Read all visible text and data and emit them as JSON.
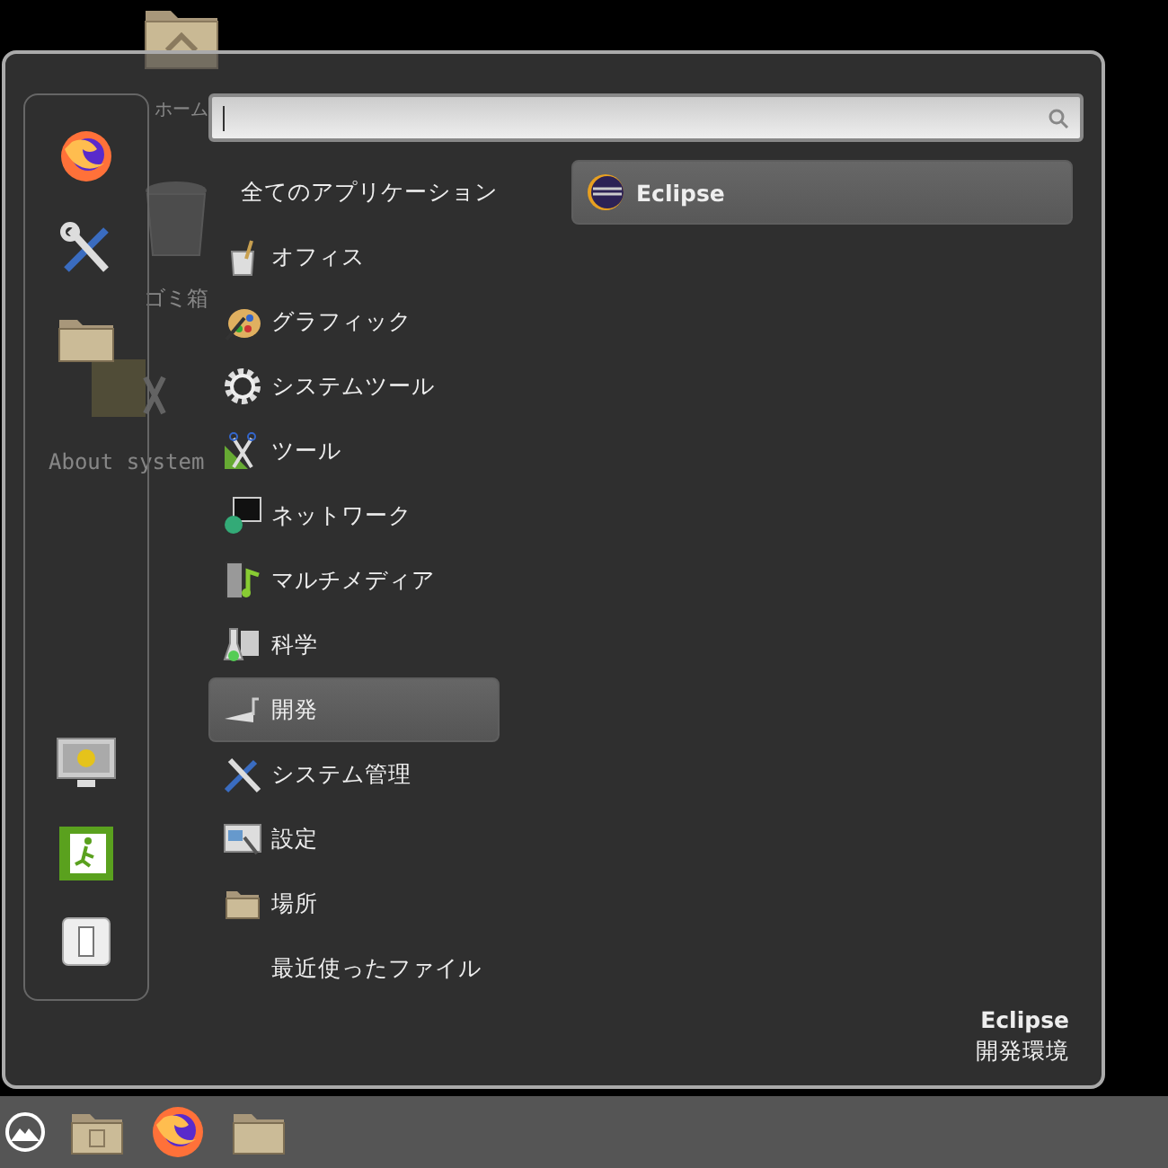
{
  "desktop_icons": [
    {
      "label": "ホーム"
    },
    {
      "label": "ゴミ箱"
    },
    {
      "label": "About system"
    }
  ],
  "categories": [
    {
      "label": "全てのアプリケーション",
      "selected": false
    },
    {
      "label": "オフィス",
      "selected": false
    },
    {
      "label": "グラフィック",
      "selected": false
    },
    {
      "label": "システムツール",
      "selected": false
    },
    {
      "label": "ツール",
      "selected": false
    },
    {
      "label": "ネットワーク",
      "selected": false
    },
    {
      "label": "マルチメディア",
      "selected": false
    },
    {
      "label": "科学",
      "selected": false
    },
    {
      "label": "開発",
      "selected": true
    },
    {
      "label": "システム管理",
      "selected": false
    },
    {
      "label": "設定",
      "selected": false
    },
    {
      "label": "場所",
      "selected": false
    },
    {
      "label": "最近使ったファイル",
      "selected": false
    }
  ],
  "applications": [
    {
      "label": "Eclipse",
      "selected": true
    }
  ],
  "description": {
    "title": "Eclipse",
    "subtitle": "開発環境"
  }
}
